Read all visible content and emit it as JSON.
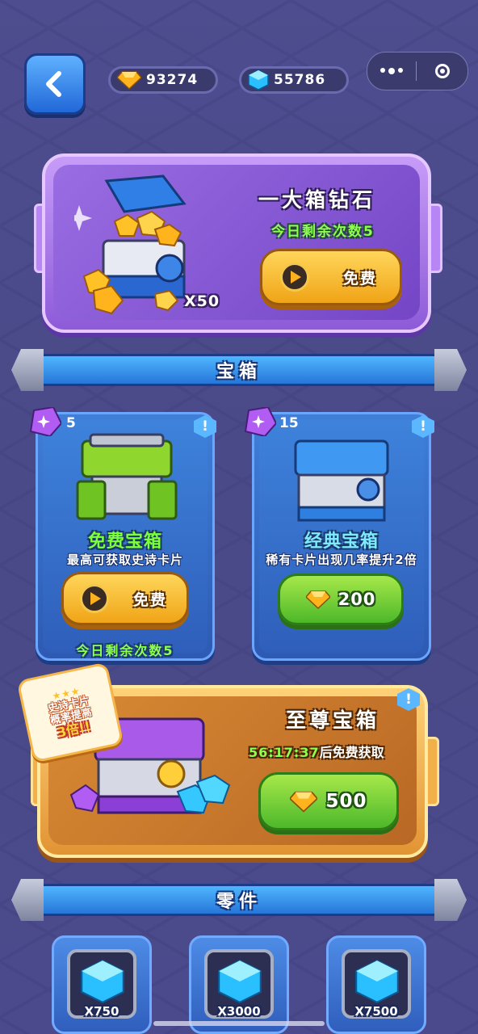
{
  "topbar": {
    "gold": "93274",
    "gems": "55786"
  },
  "diamond_offer": {
    "title": "一大箱钻石",
    "remaining": "今日剩余次数5",
    "quantity": "X50",
    "button_label": "免费"
  },
  "chest_section": {
    "title": "宝箱"
  },
  "free_chest": {
    "cost_count": "5",
    "name": "免费宝箱",
    "desc": "最高可获取史诗卡片",
    "button_label": "免费",
    "remaining": "今日剩余次数5"
  },
  "classic_chest": {
    "cost_count": "15",
    "name": "经典宝箱",
    "desc": "稀有卡片出现几率提升2倍",
    "price": "200"
  },
  "supreme_chest": {
    "badge_line1": "史诗卡片",
    "badge_line2": "概率提高",
    "badge_line3": "3倍!!",
    "title": "至尊宝箱",
    "timer": "56:17:37",
    "timer_suffix": "后免费获取",
    "price": "500"
  },
  "parts_section": {
    "title": "零件",
    "items": [
      {
        "amount": "X750"
      },
      {
        "amount": "X3000"
      },
      {
        "amount": "X7500"
      }
    ]
  },
  "colors": {
    "free_name": "#7dff3a",
    "classic_name": "#7ee9ff",
    "remaining_green": "#8dff4f"
  }
}
